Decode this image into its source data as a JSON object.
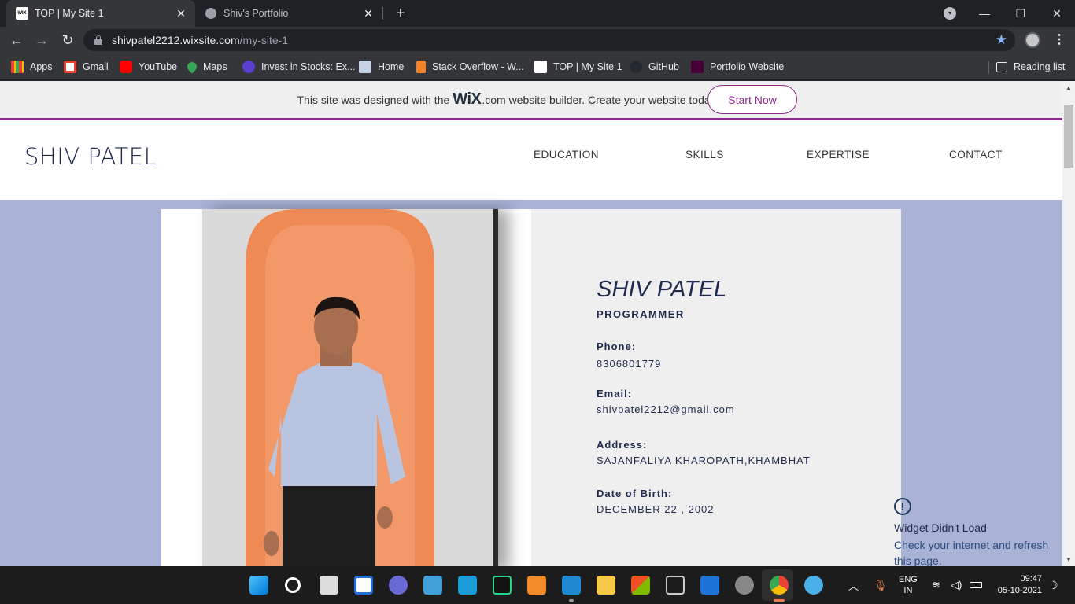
{
  "browser": {
    "tabs": [
      {
        "title": "TOP | My Site 1",
        "active": true,
        "icon": "wix-icon"
      },
      {
        "title": "Shiv's Portfolio",
        "active": false,
        "icon": "globe-icon"
      }
    ],
    "url_host": "shivpatel2212.wixsite.com",
    "url_path": "/my-site-1",
    "bookmarks": [
      {
        "label": "Apps",
        "icon": "apps-icon"
      },
      {
        "label": "Gmail",
        "icon": "gmail-icon"
      },
      {
        "label": "YouTube",
        "icon": "youtube-icon"
      },
      {
        "label": "Maps",
        "icon": "maps-icon"
      },
      {
        "label": "Invest in Stocks: Ex...",
        "icon": "stocks-icon"
      },
      {
        "label": "Home",
        "icon": "home-icon"
      },
      {
        "label": "Stack Overflow - W...",
        "icon": "stackoverflow-icon"
      },
      {
        "label": "TOP | My Site 1",
        "icon": "wix-icon"
      },
      {
        "label": "GitHub",
        "icon": "github-icon"
      },
      {
        "label": "Portfolio Website",
        "icon": "xd-icon"
      }
    ],
    "reading_list": "Reading list"
  },
  "wix_banner": {
    "text_before": "This site was designed with the",
    "logo": "WiX",
    "text_after": ".com website builder. Create your website today.",
    "button": "Start Now"
  },
  "site": {
    "name": "SHIV PATEL",
    "nav": [
      "EDUCATION",
      "SKILLS",
      "EXPERTISE",
      "CONTACT"
    ]
  },
  "profile": {
    "name": "SHIV PATEL",
    "title": "PROGRAMMER",
    "phone_label": "Phone:",
    "phone": "8306801779",
    "email_label": "Email:",
    "email": "shivpatel2212@gmail.com",
    "address_label": "Address:",
    "address": "SAJANFALIYA KHAROPATH,KHAMBHAT",
    "dob_label": "Date of Birth:",
    "dob": "DECEMBER 22 , 2002"
  },
  "widget_error": {
    "title": "Widget Didn't Load",
    "message": "Check your internet and refresh this page."
  },
  "taskbar": {
    "lang_top": "ENG",
    "lang_bottom": "IN",
    "time": "09:47",
    "date": "05-10-2021"
  },
  "colors": {
    "page_bg": "#aab2d6",
    "accent": "#8a2a8a",
    "navy": "#1f2a4d"
  }
}
